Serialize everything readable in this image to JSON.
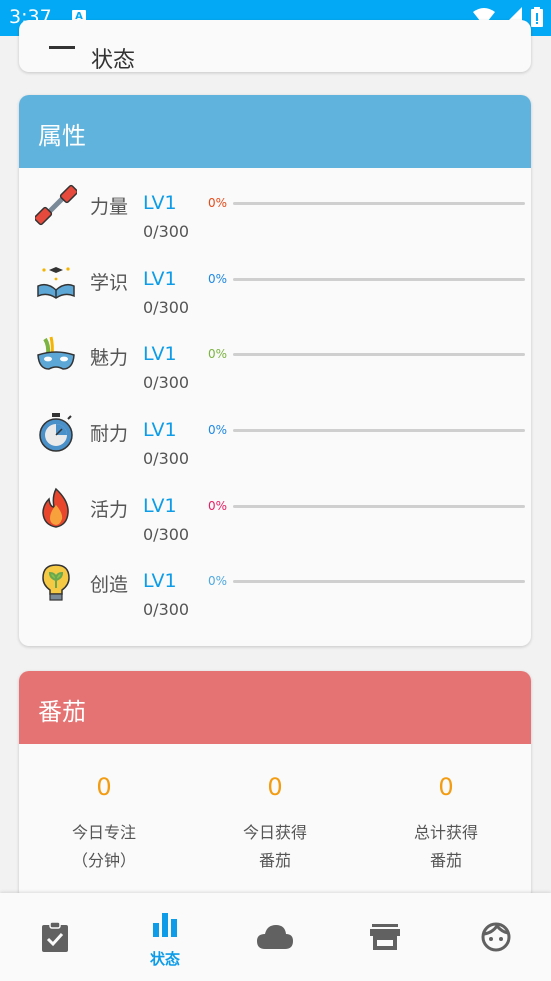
{
  "status_bar": {
    "time": "3:37",
    "notif": "A"
  },
  "prev_card": {
    "title": "状态"
  },
  "attributes": {
    "title": "属性",
    "header_color": "#5fb3dc",
    "items": [
      {
        "name": "力量",
        "level": "LV1",
        "percent": "0%",
        "progress": "0/300",
        "color": "#e64a19",
        "fraction": 0,
        "icon": "dumbbell-icon"
      },
      {
        "name": "学识",
        "level": "LV1",
        "percent": "0%",
        "progress": "0/300",
        "color": "#1e88e5",
        "fraction": 0,
        "icon": "book-icon"
      },
      {
        "name": "魅力",
        "level": "LV1",
        "percent": "0%",
        "progress": "0/300",
        "color": "#7cb342",
        "fraction": 0,
        "icon": "mask-icon"
      },
      {
        "name": "耐力",
        "level": "LV1",
        "percent": "0%",
        "progress": "0/300",
        "color": "#1e88e5",
        "fraction": 0,
        "icon": "stopwatch-icon"
      },
      {
        "name": "活力",
        "level": "LV1",
        "percent": "0%",
        "progress": "0/300",
        "color": "#e91e63",
        "fraction": 0,
        "icon": "flame-icon"
      },
      {
        "name": "创造",
        "level": "LV1",
        "percent": "0%",
        "progress": "0/300",
        "color": "#4fa8e0",
        "fraction": 0,
        "icon": "lightbulb-icon"
      }
    ]
  },
  "tomato": {
    "title": "番茄",
    "header_color": "#e57373",
    "stats": [
      {
        "value": "0",
        "label": "今日专注\n（分钟）"
      },
      {
        "value": "0",
        "label": "今日获得\n番茄"
      },
      {
        "value": "0",
        "label": "总计获得\n番茄"
      }
    ]
  },
  "bottom_nav": {
    "items": [
      {
        "name": "clipboard-check-icon",
        "label": ""
      },
      {
        "name": "bar-chart-icon",
        "label": "状态",
        "active": true
      },
      {
        "name": "cloud-icon",
        "label": ""
      },
      {
        "name": "store-icon",
        "label": ""
      },
      {
        "name": "face-icon",
        "label": ""
      }
    ],
    "active_color": "#0d9ce8"
  }
}
